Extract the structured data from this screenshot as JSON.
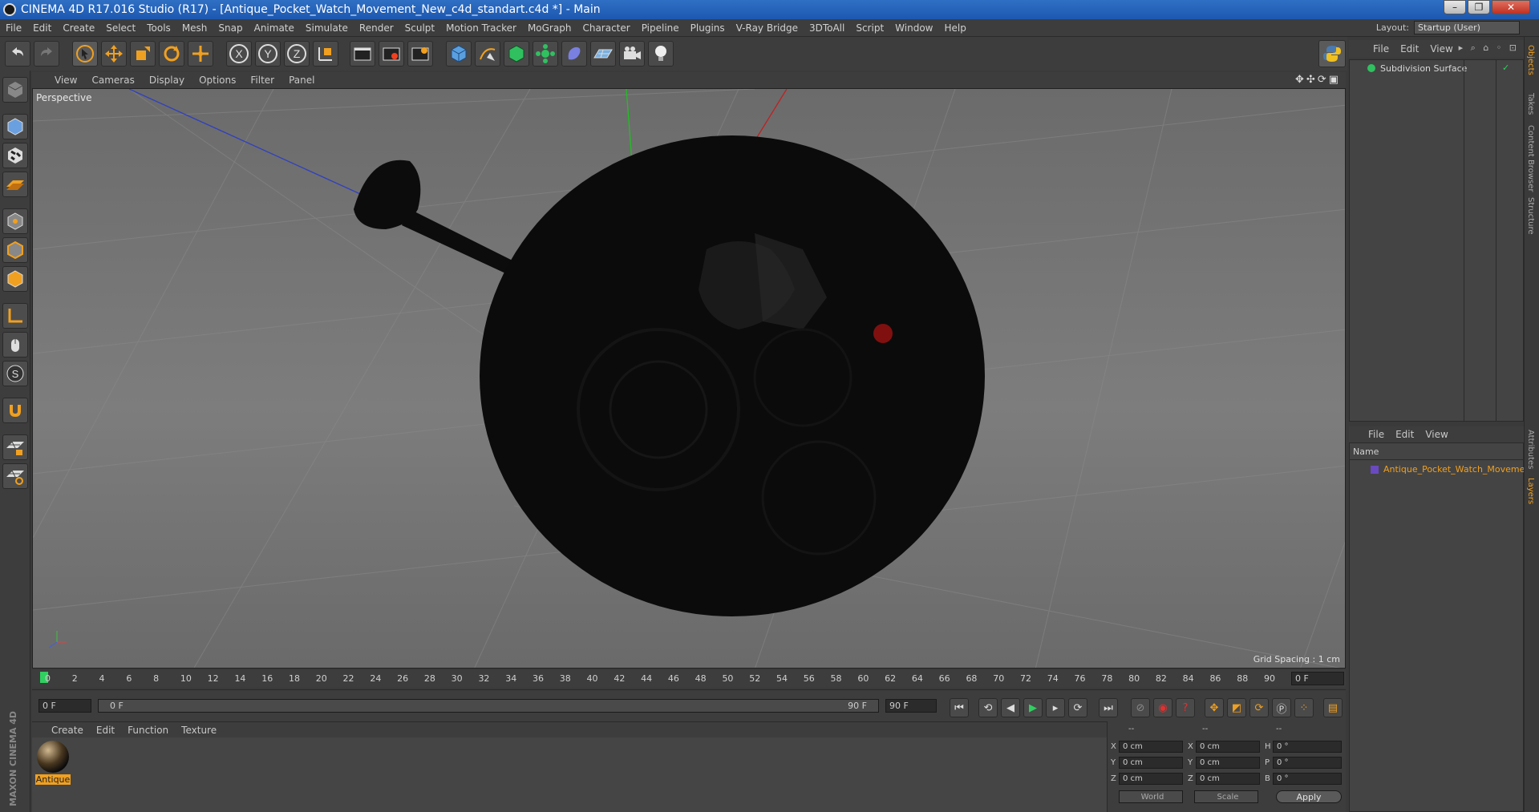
{
  "window": {
    "title": "CINEMA 4D R17.016 Studio (R17) - [Antique_Pocket_Watch_Movement_New_c4d_standart.c4d *] - Main",
    "minimize": "–",
    "maximize": "❐",
    "close": "✕"
  },
  "menu": [
    "File",
    "Edit",
    "Create",
    "Select",
    "Tools",
    "Mesh",
    "Snap",
    "Animate",
    "Simulate",
    "Render",
    "Sculpt",
    "Motion Tracker",
    "MoGraph",
    "Character",
    "Pipeline",
    "Plugins",
    "V-Ray Bridge",
    "3DToAll",
    "Script",
    "Window",
    "Help"
  ],
  "layout": {
    "label": "Layout:",
    "value": "Startup (User)"
  },
  "viewport": {
    "menu": [
      "View",
      "Cameras",
      "Display",
      "Options",
      "Filter",
      "Panel"
    ],
    "camera_label": "Perspective",
    "grid_spacing": "Grid Spacing : 1 cm"
  },
  "timeline": {
    "ticks": [
      "0",
      "2",
      "4",
      "6",
      "8",
      "10",
      "12",
      "14",
      "16",
      "18",
      "20",
      "22",
      "24",
      "26",
      "28",
      "30",
      "32",
      "34",
      "36",
      "38",
      "40",
      "42",
      "44",
      "46",
      "48",
      "50",
      "52",
      "54",
      "56",
      "58",
      "60",
      "62",
      "64",
      "66",
      "68",
      "70",
      "72",
      "74",
      "76",
      "78",
      "80",
      "82",
      "84",
      "86",
      "88",
      "90"
    ],
    "current_frame": "0 F",
    "start_frame": "0 F",
    "range_start": "0 F",
    "range_end": "90 F",
    "end_frame": "90 F"
  },
  "material_panel": {
    "menu": [
      "Create",
      "Edit",
      "Function",
      "Texture"
    ],
    "material_name": "Antique"
  },
  "coordinates": {
    "header": [
      "--",
      "--",
      "--"
    ],
    "rows": [
      {
        "a": "X",
        "av": "0 cm",
        "b": "X",
        "bv": "0 cm",
        "c": "H",
        "cv": "0 °"
      },
      {
        "a": "Y",
        "av": "0 cm",
        "b": "Y",
        "bv": "0 cm",
        "c": "P",
        "cv": "0 °"
      },
      {
        "a": "Z",
        "av": "0 cm",
        "b": "Z",
        "bv": "0 cm",
        "c": "B",
        "cv": "0 °"
      }
    ],
    "mode": "World",
    "type": "Scale",
    "apply": "Apply"
  },
  "objects_panel": {
    "menu": [
      "File",
      "Edit",
      "View"
    ],
    "item": "Subdivision Surface"
  },
  "layers_panel": {
    "menu": [
      "File",
      "Edit",
      "View"
    ],
    "header": "Name",
    "item": "Antique_Pocket_Watch_Movemen"
  },
  "side_tabs": [
    "Objects",
    "Takes",
    "Content Browser",
    "Structure",
    "Attributes",
    "Layers"
  ],
  "brand": "MAXON CINEMA 4D",
  "colors": {
    "accent": "#f0a020",
    "panel": "#3d3d3d",
    "title": "#1d58b0"
  }
}
